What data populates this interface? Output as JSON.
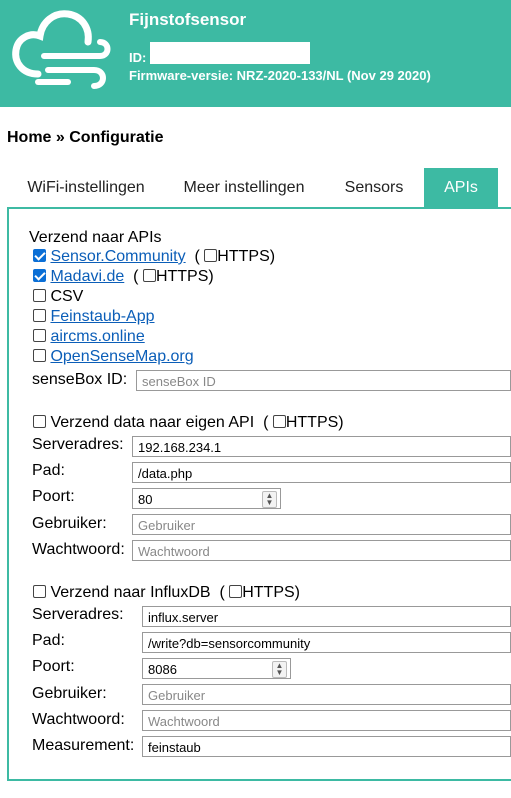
{
  "header": {
    "title": "Fijnstofsensor",
    "id_label": "ID:",
    "firmware": "Firmware-versie: NRZ-2020-133/NL (Nov 29 2020)"
  },
  "breadcrumb": "Home » Configuratie",
  "tabs": [
    {
      "label": "WiFi-instellingen",
      "active": false
    },
    {
      "label": "Meer instellingen",
      "active": false
    },
    {
      "label": "Sensors",
      "active": false
    },
    {
      "label": "APIs",
      "active": true
    }
  ],
  "apis": {
    "heading": "Verzend naar APIs",
    "sensor_community": {
      "label": "Sensor.Community",
      "checked": true,
      "https_label": "HTTPS",
      "https_checked": false
    },
    "madavi": {
      "label": "Madavi.de",
      "checked": true,
      "https_label": "HTTPS",
      "https_checked": false
    },
    "csv": {
      "label": "CSV",
      "checked": false
    },
    "feinstaub": {
      "label": "Feinstaub-App",
      "checked": false
    },
    "aircms": {
      "label": "aircms.online",
      "checked": false
    },
    "opensensemap": {
      "label": "OpenSenseMap.org",
      "checked": false
    },
    "sensebox_label": "senseBox ID:",
    "sensebox_placeholder": "senseBox ID"
  },
  "custom_api": {
    "heading": "Verzend data naar eigen API",
    "checked": false,
    "https_label": "HTTPS",
    "https_checked": false,
    "server_label": "Serveradres:",
    "server_value": "192.168.234.1",
    "path_label": "Pad:",
    "path_value": "/data.php",
    "port_label": "Poort:",
    "port_value": "80",
    "user_label": "Gebruiker:",
    "user_placeholder": "Gebruiker",
    "pass_label": "Wachtwoord:",
    "pass_placeholder": "Wachtwoord"
  },
  "influx": {
    "heading": "Verzend naar InfluxDB",
    "checked": false,
    "https_label": "HTTPS",
    "https_checked": false,
    "server_label": "Serveradres:",
    "server_value": "influx.server",
    "path_label": "Pad:",
    "path_value": "/write?db=sensorcommunity",
    "port_label": "Poort:",
    "port_value": "8086",
    "user_label": "Gebruiker:",
    "user_placeholder": "Gebruiker",
    "pass_label": "Wachtwoord:",
    "pass_placeholder": "Wachtwoord",
    "measurement_label": "Measurement:",
    "measurement_value": "feinstaub"
  },
  "colors": {
    "accent": "#3dbaa3",
    "link": "#0b5eb8",
    "checkbox": "#0b6fd6"
  }
}
